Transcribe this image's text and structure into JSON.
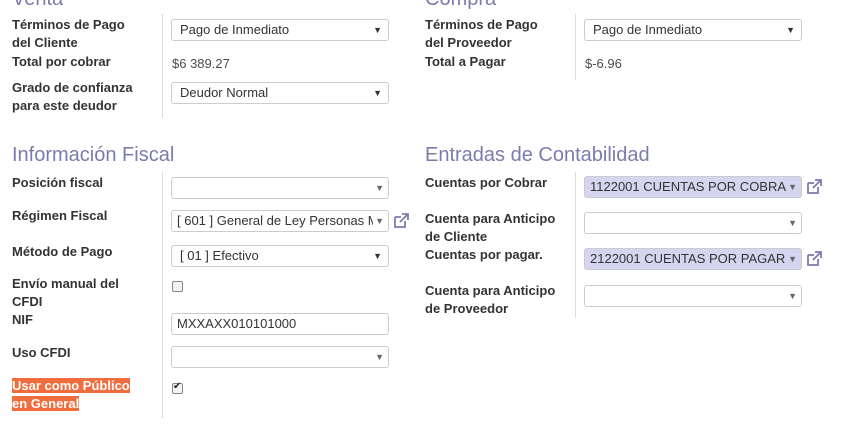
{
  "venta": {
    "title": "Venta",
    "terms_label_1": "Términos de Pago",
    "terms_label_2": "del Cliente",
    "terms_value": "Pago de Inmediato",
    "receivable_label": "Total por cobrar",
    "receivable_value": "$6 389.27",
    "trust_label_1": "Grado de confianza",
    "trust_label_2": "para este deudor",
    "trust_value": "Deudor Normal"
  },
  "compra": {
    "title": "Compra",
    "terms_label_1": "Términos de Pago",
    "terms_label_2": "del Proveedor",
    "terms_value": "Pago de Inmediato",
    "payable_label": "Total a Pagar",
    "payable_value": "$-6.96"
  },
  "fiscal": {
    "title": "Información Fiscal",
    "position_label": "Posición fiscal",
    "position_value": "",
    "regimen_label": "Régimen Fiscal",
    "regimen_value": "[ 601 ] General de Ley Personas M",
    "metodo_label": "Método de Pago",
    "metodo_value": "[ 01 ] Efectivo",
    "envio_label_1": "Envío manual del",
    "envio_label_2": "CFDI",
    "envio_checked": false,
    "nif_label": "NIF",
    "nif_value": "MXXAXX010101000",
    "uso_label": "Uso CFDI",
    "uso_value": "",
    "publico_label_1": "Usar como Público",
    "publico_label_2": "en General",
    "publico_checked": true
  },
  "contabilidad": {
    "title": "Entradas de Contabilidad",
    "cobrar_label": "Cuentas por Cobrar",
    "cobrar_value": "1122001 CUENTAS POR COBRA",
    "anticipo_cliente_label_1": "Cuenta para Anticipo",
    "anticipo_cliente_label_2": "de Cliente",
    "anticipo_cliente_value": "",
    "pagar_label": "Cuentas por pagar.",
    "pagar_value": "2122001 CUENTAS POR PAGAR",
    "anticipo_proveedor_label_1": "Cuenta para Anticipo",
    "anticipo_proveedor_label_2": "de Proveedor",
    "anticipo_proveedor_value": ""
  },
  "icons": {
    "caret": "▼",
    "external": "external-link-icon",
    "check": "✔"
  },
  "colors": {
    "section_title": "#7c7bad",
    "m2o_filled": "#d6d5f0",
    "highlight": "#f26d3d"
  }
}
